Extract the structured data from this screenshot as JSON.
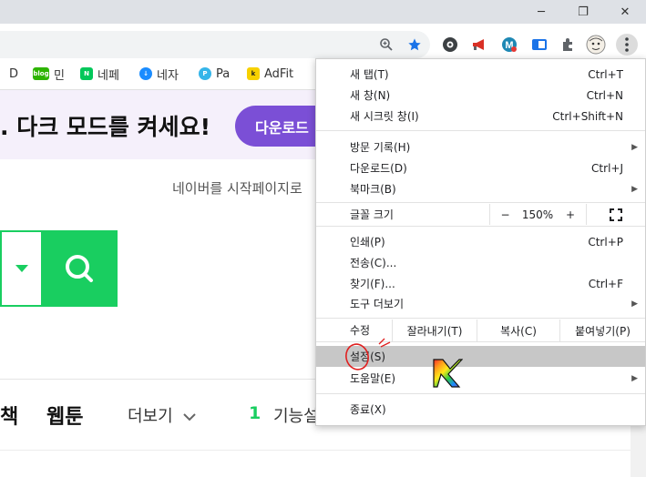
{
  "window": {
    "minimize": "─",
    "restore": "❐",
    "close": "✕"
  },
  "toolbar": {
    "icons": [
      "zoom-icon",
      "star-icon",
      "extension-eye-icon",
      "megaphone-icon",
      "m-extension-icon",
      "tab-extension-icon",
      "puzzle-icon",
      "profile-avatar",
      "menu-kebab-icon"
    ]
  },
  "bookmarks": [
    {
      "label": "D",
      "icon": "",
      "color": "#ffffff"
    },
    {
      "label": "민",
      "icon": "blog",
      "color": "#2db400"
    },
    {
      "label": "네페",
      "icon": "N",
      "color": "#03c75a"
    },
    {
      "label": "네자",
      "icon": "↓",
      "color": "#1a8cff"
    },
    {
      "label": "Pa",
      "icon": "P",
      "color": "#35b5e9"
    },
    {
      "label": "AdFit",
      "icon": "k",
      "color": "#f7d100"
    }
  ],
  "page": {
    "banner_text": ". 다크 모드를 켜세요!",
    "banner_button": "다운로드",
    "startpage_text": "네이버를 시작페이지로",
    "nav": {
      "item1": "책",
      "item2": "웹툰",
      "more": "더보기",
      "func_count": "1",
      "func_label": "기능설정"
    }
  },
  "menu": {
    "new_tab": {
      "label": "새 탭(T)",
      "shortcut": "Ctrl+T"
    },
    "new_window": {
      "label": "새 창(N)",
      "shortcut": "Ctrl+N"
    },
    "incognito": {
      "label": "새 시크릿 창(I)",
      "shortcut": "Ctrl+Shift+N"
    },
    "history": {
      "label": "방문 기록(H)"
    },
    "downloads": {
      "label": "다운로드(D)",
      "shortcut": "Ctrl+J"
    },
    "bookmarks": {
      "label": "북마크(B)"
    },
    "zoom": {
      "label": "글꼴 크기",
      "minus": "−",
      "value": "150%",
      "plus": "+"
    },
    "print": {
      "label": "인쇄(P)",
      "shortcut": "Ctrl+P"
    },
    "cast": {
      "label": "전송(C)..."
    },
    "find": {
      "label": "찾기(F)...",
      "shortcut": "Ctrl+F"
    },
    "more_tools": {
      "label": "도구 더보기"
    },
    "edit": {
      "label": "수정",
      "cut": "잘라내기(T)",
      "copy": "복사(C)",
      "paste": "붙여넣기(P)"
    },
    "settings": {
      "label": "설정(S)"
    },
    "help": {
      "label": "도움말(E)"
    },
    "exit": {
      "label": "종료(X)"
    }
  }
}
